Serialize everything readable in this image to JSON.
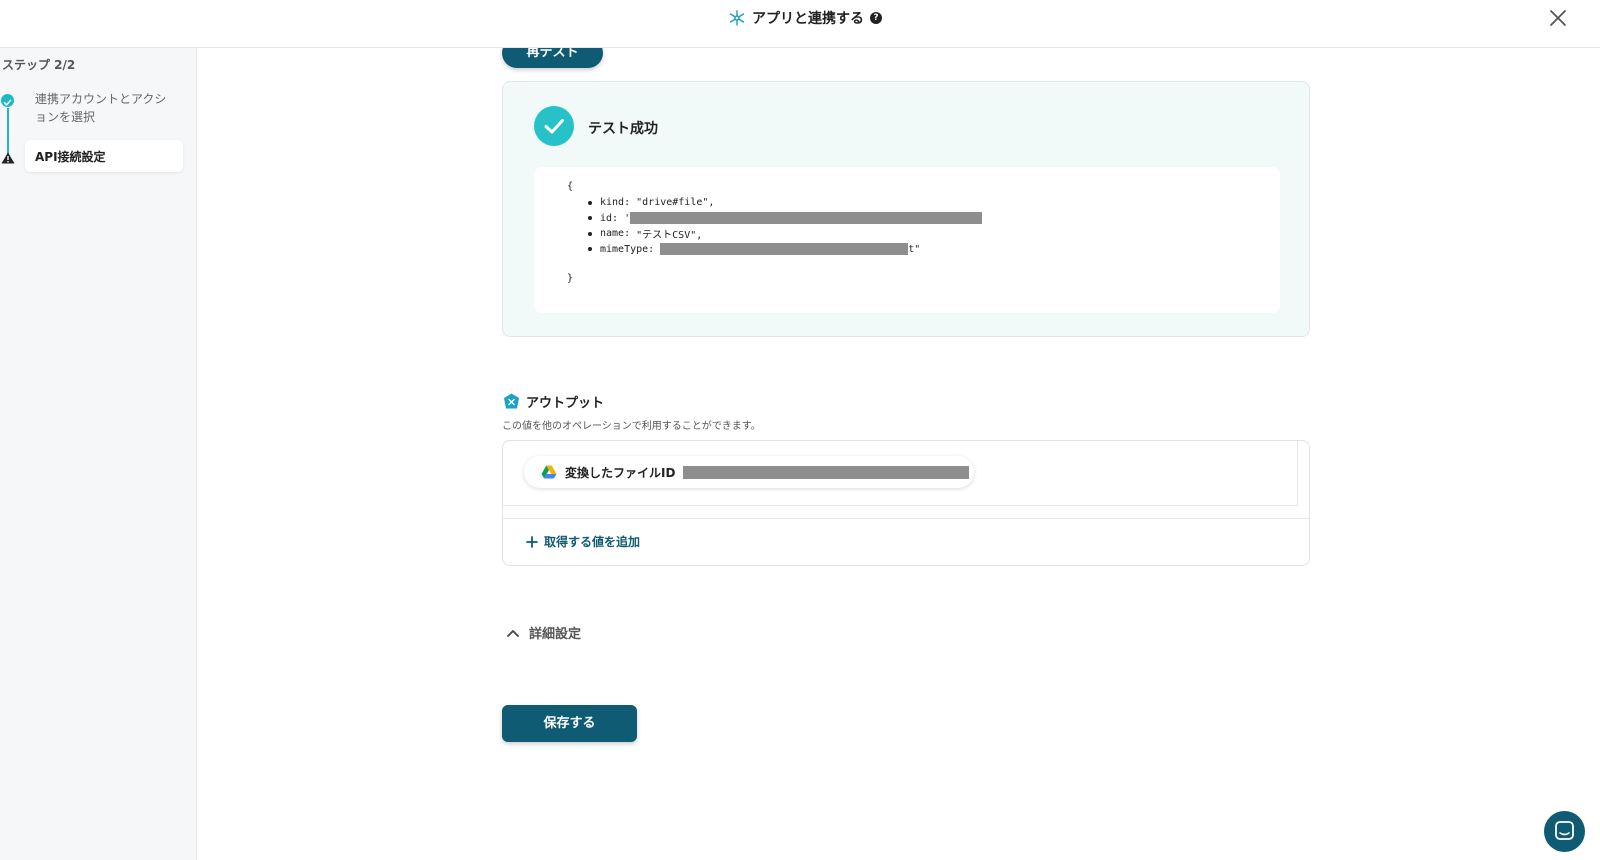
{
  "header": {
    "title": "アプリと連携する",
    "help": "?"
  },
  "sidebar": {
    "step_label": "ステップ 2/2",
    "steps": [
      {
        "label": "連携アカウントとアクションを選択",
        "status": "complete"
      },
      {
        "label": "API接続設定",
        "status": "warning"
      }
    ]
  },
  "main": {
    "retest_label": "再テスト",
    "success_title": "テスト成功",
    "json": {
      "open": "{",
      "close": "}",
      "lines": [
        {
          "key": "kind:",
          "value": "\"drive#file\","
        },
        {
          "key": "id:",
          "value": "'"
        },
        {
          "key": "name:",
          "value": "\"テストCSV\","
        },
        {
          "key": "mimeType:",
          "value": "",
          "suffix": "t\""
        }
      ]
    },
    "output": {
      "title": "アウトプット",
      "description": "この値を他のオペレーションで利用することができます。",
      "chip_label": "変換したファイルID",
      "add_label": "取得する値を追加"
    },
    "advanced_label": "詳細設定",
    "save_label": "保存する"
  },
  "colors": {
    "accent": "#0f5b74",
    "success": "#27c1c8",
    "step_line": "#1fb8c9"
  }
}
